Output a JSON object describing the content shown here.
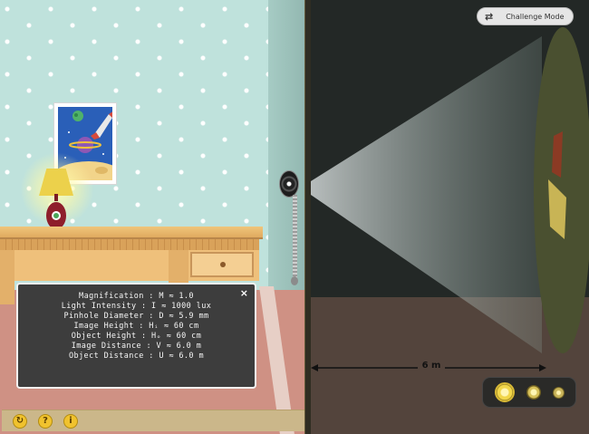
{
  "challenge_mode": {
    "label": "Challenge Mode",
    "icon": "swap-arrows-icon"
  },
  "info_panel": {
    "lines": [
      "Magnification : M ≈ 1.0",
      "Light Intensity : I ≈ 1000 lux",
      "Pinhole Diameter : D ≈ 5.9 mm",
      "Image Height : Hᵢ ≈ 60 cm",
      "Object Height : Hₒ ≈ 60 cm",
      "Image Distance : V ≈ 6.0 m",
      "Object Distance : U ≈ 6.0 m"
    ],
    "close": "×"
  },
  "distance": {
    "label": "6 m"
  },
  "toolbar": {
    "reset": "↻",
    "help": "?",
    "info": "i"
  },
  "light_selector": {
    "levels": [
      "high",
      "medium",
      "low"
    ],
    "selected": "high"
  },
  "colors": {
    "wall": "#bfe2dc",
    "dark_room": "#232826",
    "floor": "#cf9184",
    "panel": "#3d3d3d",
    "accent_yellow": "#f0c22e"
  }
}
